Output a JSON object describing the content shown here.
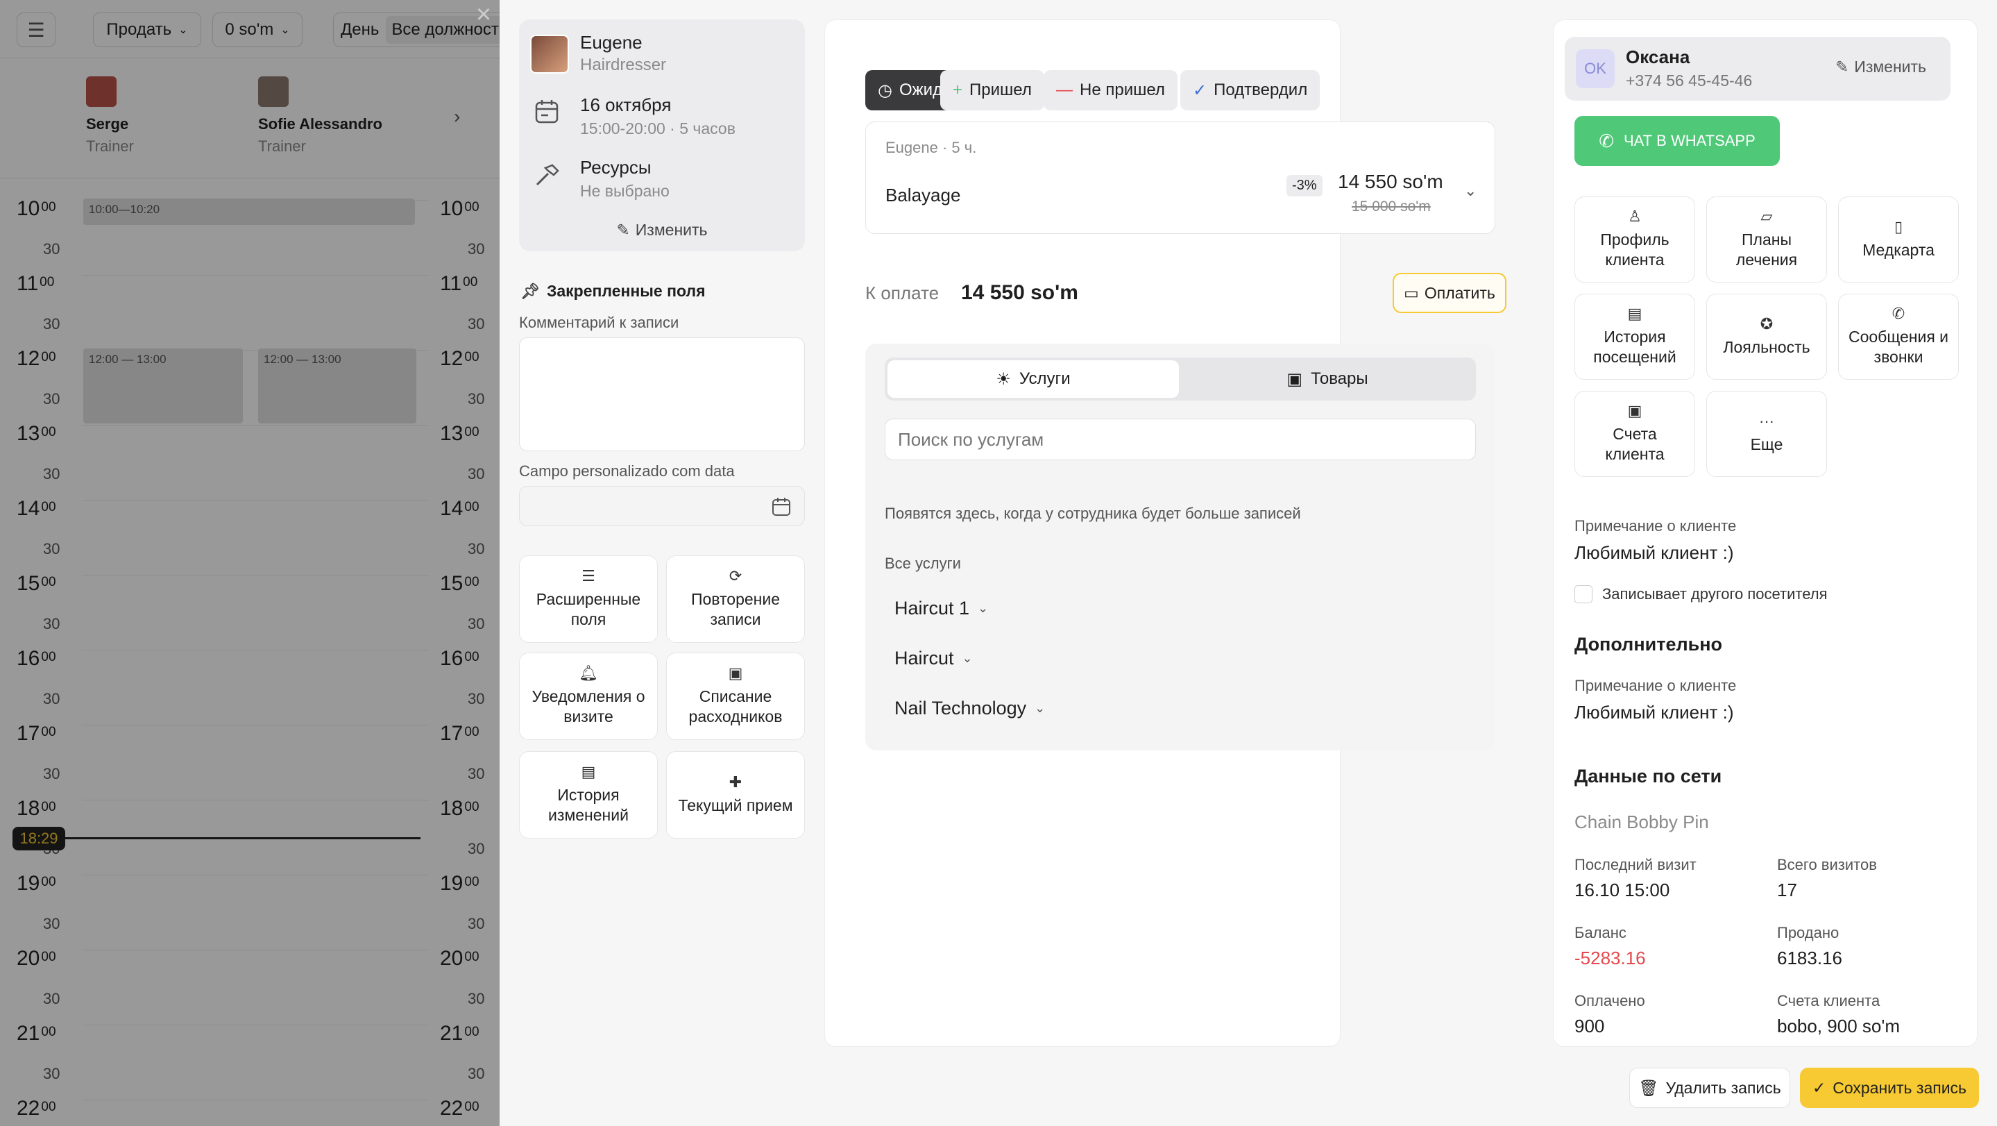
{
  "calendar": {
    "menu_icon": "hamburger-icon",
    "sell_label": "Продать",
    "amount_label": "0 so'm",
    "view_label": "День",
    "positions_label": "Все должности",
    "staff": [
      {
        "name": "Serge",
        "role": "Trainer"
      },
      {
        "name": "Sofie Alessandro",
        "role": "Trainer"
      }
    ],
    "hours": [
      "10",
      "11",
      "12",
      "13",
      "14",
      "15",
      "16",
      "17",
      "18",
      "19",
      "20",
      "21",
      "22"
    ],
    "minutes": "00",
    "half": "30",
    "events": [
      "10:00—10:20",
      "12:00 — 13:00",
      "12:00 — 13:00"
    ],
    "current_time": "18:29"
  },
  "summary": {
    "master_name": "Eugene",
    "master_role": "Hairdresser",
    "date": "16 октября",
    "time": "15:00-20:00 · 5 часов",
    "resources_title": "Ресурсы",
    "resources_value": "Не выбрано",
    "edit_label": "Изменить",
    "pinned_title": "Закрепленные поля",
    "comment_label": "Комментарий к записи",
    "custom_date_label": "Campo personalizado com data",
    "tiles": [
      {
        "icon": "list-icon",
        "label": "Расширенные поля"
      },
      {
        "icon": "repeat-icon",
        "label": "Повторение записи"
      },
      {
        "icon": "bell-icon",
        "label": "Уведомления о визите"
      },
      {
        "icon": "box-icon",
        "label": "Списание расходников"
      },
      {
        "icon": "history-icon",
        "label": "История изменений"
      },
      {
        "icon": "cross-icon",
        "label": "Текущий прием"
      }
    ]
  },
  "record": {
    "statuses": [
      {
        "icon": "clock-icon",
        "label": "Ожидание",
        "active": true
      },
      {
        "icon": "plus-icon",
        "label": "Пришел",
        "active": false
      },
      {
        "icon": "minus-icon",
        "label": "Не пришел",
        "active": false
      },
      {
        "icon": "check-icon",
        "label": "Подтвердил",
        "active": false
      }
    ],
    "service_meta": "Eugene · 5 ч.",
    "service_name": "Balayage",
    "discount": "-3%",
    "price": "14 550 so'm",
    "old_price": "15 000 so'm",
    "to_pay_label": "К оплате",
    "to_pay_value": "14 550 so'm",
    "pay_button": "Оплатить",
    "tab_services": "Услуги",
    "tab_goods": "Товары",
    "search_placeholder": "Поиск по услугам",
    "empty_note": "Появятся здесь, когда у сотрудника будет больше записей",
    "all_services": "Все услуги",
    "categories": [
      "Haircut 1",
      "Haircut",
      "Nail Technology"
    ]
  },
  "client": {
    "initials": "OK",
    "name": "Оксана",
    "phone": "+374 56 45-45-46",
    "edit_label": "Изменить",
    "whatsapp_label": "ЧАТ В WHATSAPP",
    "tiles": [
      {
        "icon": "user-icon",
        "label": "Профиль клиента"
      },
      {
        "icon": "folder-icon",
        "label": "Планы лечения"
      },
      {
        "icon": "medcard-icon",
        "label": "Медкарта"
      },
      {
        "icon": "visits-icon",
        "label": "История посещений"
      },
      {
        "icon": "loyalty-icon",
        "label": "Лояльность"
      },
      {
        "icon": "phone-icon",
        "label": "Сообщения и звонки"
      },
      {
        "icon": "wallet-icon",
        "label": "Счета клиента"
      },
      {
        "icon": "more-icon",
        "label": "Еще"
      }
    ],
    "note_label": "Примечание о клиенте",
    "note_value": "Любимый клиент :)",
    "other_visitor_label": "Записывает другого посетителя",
    "additional_title": "Дополнительно",
    "add_note_label": "Примечание о клиенте",
    "add_note_value": "Любимый клиент :)",
    "network_title": "Данные по сети",
    "network_name": "Chain Bobby Pin",
    "last_visit_label": "Последний визит",
    "last_visit_value": "16.10 15:00",
    "total_visits_label": "Всего визитов",
    "total_visits_value": "17",
    "balance_label": "Баланс",
    "balance_value": "-5283.16",
    "sold_label": "Продано",
    "sold_value": "6183.16",
    "paid_label": "Оплачено",
    "paid_value": "900",
    "accounts_label": "Счета клиента",
    "accounts_value": "bobo, 900 so'm"
  },
  "footer": {
    "delete_label": "Удалить запись",
    "save_label": "Сохранить запись"
  },
  "colors": {
    "accent_yellow": "#f7c933",
    "whatsapp_green": "#4fc878",
    "balance_red": "#e5484d",
    "active_status": "#3a3a3c"
  }
}
